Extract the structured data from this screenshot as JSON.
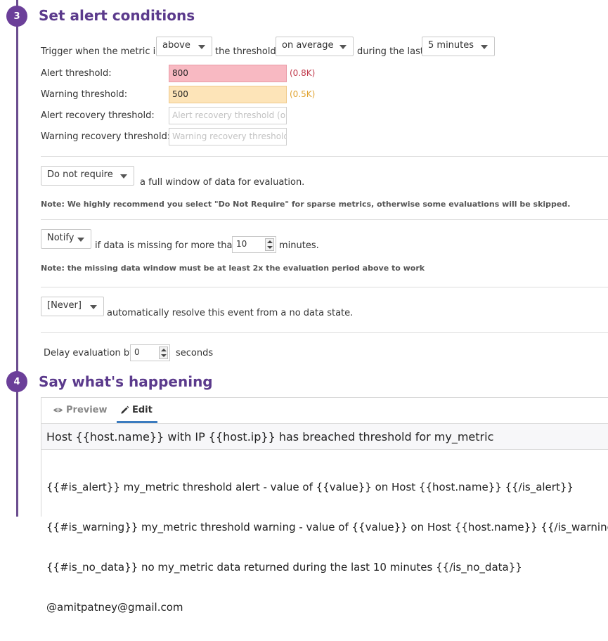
{
  "step3": {
    "number": "3",
    "title": "Set alert conditions",
    "trigger": {
      "prefix": "Trigger when the metric is",
      "comparison": "above",
      "mid": "the threshold",
      "aggregation": "on average",
      "suffix": "during the last",
      "window": "5 minutes"
    },
    "thresholds": {
      "alert_label": "Alert threshold:",
      "alert_value": "800",
      "alert_hint": "(0.8K)",
      "warning_label": "Warning threshold:",
      "warning_value": "500",
      "warning_hint": "(0.5K)",
      "alert_recovery_label": "Alert recovery threshold:",
      "alert_recovery_placeholder": "Alert recovery threshold (optional)",
      "warning_recovery_label": "Warning recovery threshold:",
      "warning_recovery_placeholder": "Warning recovery threshold (optional)"
    },
    "full_window": {
      "select": "Do not require",
      "text": "a full window of data for evaluation.",
      "note": "Note: We highly recommend you select \"Do Not Require\" for sparse metrics, otherwise some evaluations will be skipped."
    },
    "missing_data": {
      "select": "Notify",
      "text": "if data is missing for more than",
      "minutes": "10",
      "unit": "minutes.",
      "note": "Note: the missing data window must be at least 2x the evaluation period above to work"
    },
    "resolve": {
      "select": "[Never]",
      "text": "automatically resolve this event from a no data state."
    },
    "delay": {
      "label": "Delay evaluation by",
      "value": "0",
      "unit": "seconds"
    }
  },
  "step4": {
    "number": "4",
    "title": "Say what's happening",
    "tabs": {
      "preview": "Preview",
      "edit": "Edit"
    },
    "subject": "Host {{host.name}} with IP {{host.ip}} has breached threshold for my_metric",
    "body_lines": [
      "{{#is_alert}} my_metric threshold alert - value of {{value}} on Host {{host.name}} {{/is_alert}}",
      "{{#is_warning}} my_metric threshold warning - value of {{value}} on Host {{host.name}} {{/is_warning}}",
      "{{#is_no_data}} no my_metric data returned during the last 10 minutes {{/is_no_data}}",
      "@amitpatney@gmail.com"
    ]
  },
  "colors": {
    "accent": "#6b3f99",
    "alert_bg": "#f8b9c2",
    "alert_hint": "#c0394b",
    "warning_bg": "#fde4b8",
    "warning_hint": "#e0a330",
    "tab_underline": "#3b7bbf"
  }
}
